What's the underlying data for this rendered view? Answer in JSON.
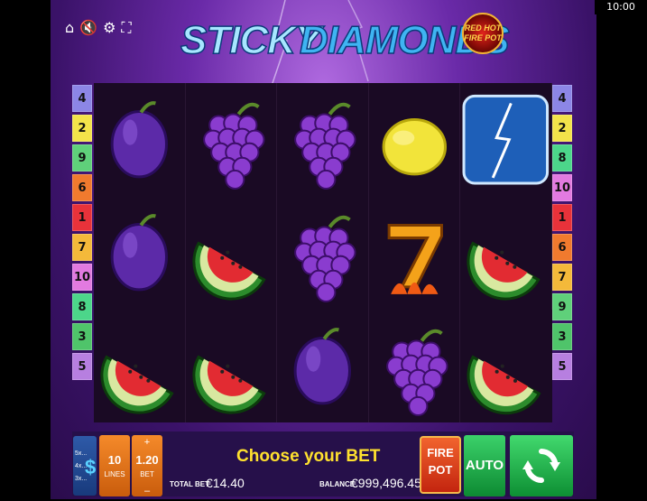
{
  "status_bar": {
    "clock": "10:00"
  },
  "top_icons": [
    "home-icon",
    "sound-muted-icon",
    "settings-icon",
    "fullscreen-icon"
  ],
  "logo": {
    "word1": "STICKY",
    "word2": "DIAMONDS",
    "seal_line1": "RED HOT",
    "seal_line2": "FIRE POT"
  },
  "paylines_left": [
    "4",
    "2",
    "9",
    "6",
    "1",
    "7",
    "10",
    "8",
    "3",
    "5"
  ],
  "paylines_right": [
    "4",
    "2",
    "8",
    "10",
    "1",
    "6",
    "7",
    "9",
    "3",
    "5"
  ],
  "payline_colors": {
    "1": "#e8323a",
    "2": "#f3e34a",
    "3": "#4fc46a",
    "4": "#8c86e6",
    "5": "#b77fe0",
    "6": "#f07a2e",
    "7": "#f4b93a",
    "8": "#4cd68a",
    "9": "#5fd07a",
    "10": "#e27ae0"
  },
  "reels": [
    [
      "plum",
      "grapes",
      "grapes",
      "lemon",
      "lightning-diamond"
    ],
    [
      "plum",
      "watermelon",
      "grapes",
      "seven",
      "watermelon"
    ],
    [
      "watermelon",
      "watermelon",
      "plum",
      "grapes",
      "watermelon"
    ]
  ],
  "bottom_bar": {
    "multiplier_labels": [
      "5x...",
      "4x...",
      "3x..."
    ],
    "lines_value": "10",
    "lines_label": "LINES",
    "bet_plus": "+",
    "bet_value": "1.20",
    "bet_label": "BET",
    "bet_minus": "–",
    "message": "Choose your BET",
    "total_bet_label": "TOTAL BET",
    "total_bet_value": "€14.40",
    "balance_label": "BALANCE",
    "balance_value": "€999,496.45",
    "firepot_line1": "FIRE",
    "firepot_line2": "POT",
    "auto_label": "AUTO"
  }
}
